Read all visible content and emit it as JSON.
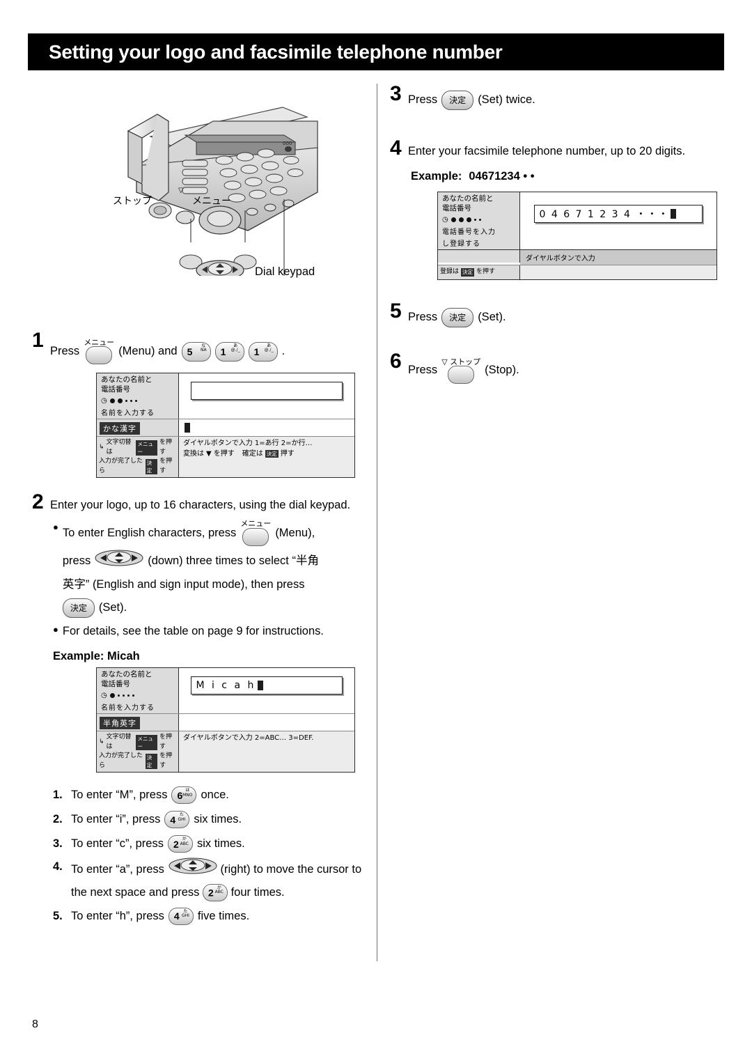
{
  "header": {
    "title": "Setting your logo and facsimile telephone number"
  },
  "page_number": "8",
  "illustration": {
    "label_stop": "ストップ",
    "label_menu": "メニュー",
    "label_dial_keypad": "Dial keypad"
  },
  "left_column": {
    "step1": {
      "num": "1",
      "text_press": "Press",
      "menu_key_label": "メニュー",
      "text_and": "(Menu) and",
      "keys": [
        {
          "main": "5",
          "sub_top": "な",
          "sub_bottom": "NA"
        },
        {
          "main": "1",
          "sub_top": "あ",
          "sub_bottom": "@./_"
        },
        {
          "main": "1",
          "sub_top": "あ",
          "sub_bottom": "@./_"
        }
      ],
      "period": "."
    },
    "lcd1": {
      "title_line1": "あなたの名前と",
      "title_line2": "電話番号",
      "sub": "名前を入力する",
      "mode_chip": "かな漢字",
      "bl_line1_a": "文字切替は",
      "bl_chip1": "メニュー",
      "bl_line1_b": "を押す",
      "bl_line2_a": "入力が完了したら",
      "bl_chip2": "決定",
      "bl_line2_b": "を押す",
      "br_line1": "ダイヤルボタンで入力  1=あ行 2=か行…",
      "br_line2_a": "変換は",
      "br_line2_b": "を押す",
      "br_line2_c": "確定は",
      "br_chip": "決定",
      "br_line2_d": "押す"
    },
    "step2": {
      "num": "2",
      "text": "Enter your logo, up to 16 characters, using the dial keypad.",
      "bullet1_a": "To enter English characters, press",
      "menu_key_label": "メニュー",
      "bullet1_b": "(Menu),",
      "bullet1_c": "press",
      "bullet1_d": "(down) three times to select “半角",
      "bullet1_e": "英字” (English and sign input mode), then press",
      "set_key": "決定",
      "bullet1_f": "(Set).",
      "bullet2": "For details, see the table on page 9 for instructions.",
      "example_title": "Example: Micah"
    },
    "lcd2": {
      "title_line1": "あなたの名前と",
      "title_line2": "電話番号",
      "sub": "名前を入力する",
      "value": "M i c a h",
      "mode_chip": "半角英字",
      "bl_line1_a": "文字切替は",
      "bl_chip1": "メニュー",
      "bl_line1_b": "を押す",
      "bl_line2_a": "入力が完了したら",
      "bl_chip2": "決定",
      "bl_line2_b": "を押す",
      "br_line1": "ダイヤルボタンで入力  2=ABC…  3=DEF."
    },
    "substeps": [
      {
        "n": "1.",
        "a": "To enter “M”, press",
        "key": {
          "main": "6",
          "sub_top": "は",
          "sub_bottom": "MNO"
        },
        "b": "once."
      },
      {
        "n": "2.",
        "a": "To enter “i”, press",
        "key": {
          "main": "4",
          "sub_top": "た",
          "sub_bottom": "GHI"
        },
        "b": "six times."
      },
      {
        "n": "3.",
        "a": "To enter “c”, press",
        "key": {
          "main": "2",
          "sub_top": "か",
          "sub_bottom": "ABC"
        },
        "b": "six times."
      },
      {
        "n": "4.",
        "a": "To enter “a”, press",
        "b": "(right) to move the cursor to the next space and press",
        "key": {
          "main": "2",
          "sub_top": "か",
          "sub_bottom": "ABC"
        },
        "c": "four times."
      },
      {
        "n": "5.",
        "a": "To enter “h”, press",
        "key": {
          "main": "4",
          "sub_top": "た",
          "sub_bottom": "GHI"
        },
        "b": "five times."
      }
    ]
  },
  "right_column": {
    "step3": {
      "num": "3",
      "a": "Press",
      "key": "決定",
      "b": "(Set) twice."
    },
    "step4": {
      "num": "4",
      "text": "Enter your facsimile telephone number, up to 20 digits.",
      "example_label": "Example:",
      "example_value": "04671234 • •"
    },
    "lcd3": {
      "title_line1": "あなたの名前と",
      "title_line2": "電話番号",
      "sub_line1": "電話番号を入力",
      "sub_line2": "し登録する",
      "value": "0 4 6 7 1 2 3 4 ・・・",
      "band": "ダイヤルボタンで入力",
      "bl_a": "登録は",
      "bl_chip": "決定",
      "bl_b": "を押す"
    },
    "step5": {
      "num": "5",
      "a": "Press",
      "key": "決定",
      "b": "(Set)."
    },
    "step6": {
      "num": "6",
      "a": "Press",
      "key_label": "ストップ",
      "b": "(Stop)."
    }
  }
}
